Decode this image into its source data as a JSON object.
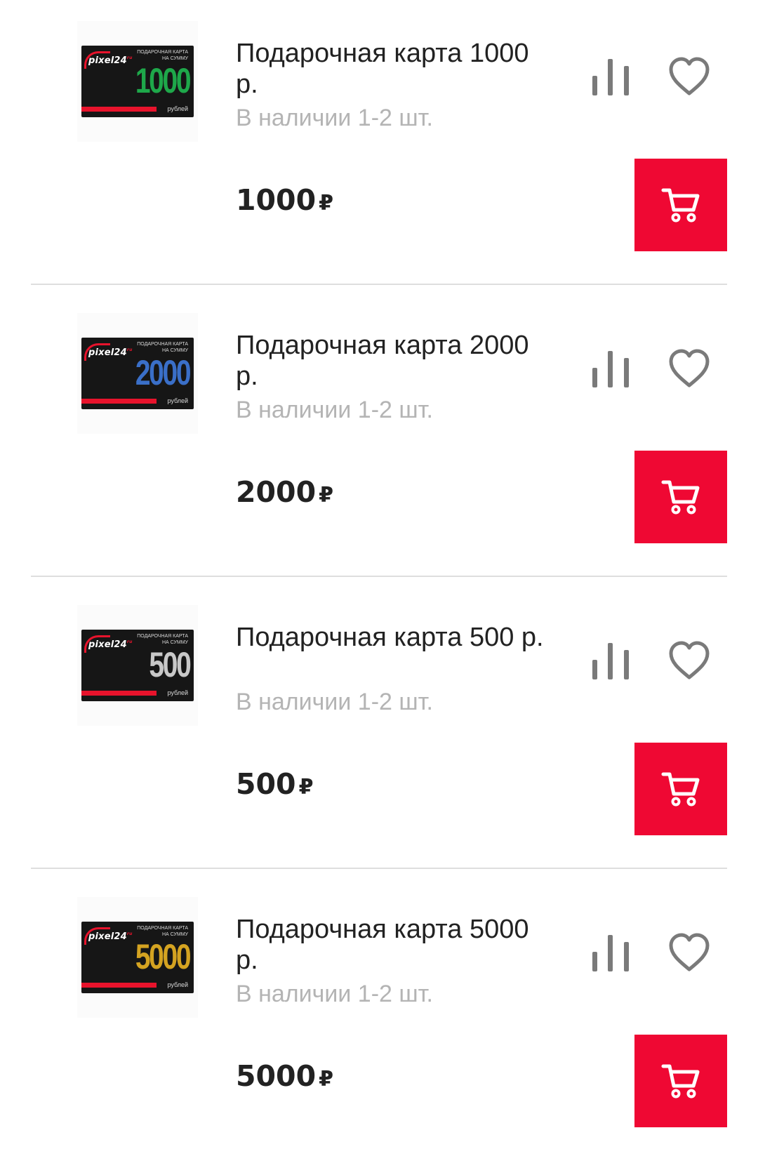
{
  "colors": {
    "accent_red": "#ef0833",
    "title_text": "#222222",
    "stock_text": "#b4b4b4",
    "divider": "#dedede",
    "icon_gray": "#7a7a7a"
  },
  "card_caption_line1": "ПОДАРОЧНАЯ КАРТА",
  "card_caption_line2": "НА СУММУ",
  "card_rub_label": "рублей",
  "card_logo": "pixel24",
  "card_logo_suffix": "ru",
  "icons": {
    "compare": "bar-chart-icon",
    "favorite": "heart-icon",
    "cart": "shopping-cart-icon"
  },
  "products": [
    {
      "title": "Подарочная карта 1000 р.",
      "stock": "В наличии 1-2 шт.",
      "price": "1000",
      "currency": "₽",
      "card_amount": "1000",
      "card_color": "#1ea84a"
    },
    {
      "title": "Подарочная карта 2000 р.",
      "stock": "В наличии 1-2 шт.",
      "price": "2000",
      "currency": "₽",
      "card_amount": "2000",
      "card_color": "#3a6fc8"
    },
    {
      "title": "Подарочная карта 500 р.",
      "stock": "В наличии 1-2 шт.",
      "price": "500",
      "currency": "₽",
      "card_amount": "500",
      "card_color": "#c8c8c8"
    },
    {
      "title": "Подарочная карта 5000 р.",
      "stock": "В наличии 1-2 шт.",
      "price": "5000",
      "currency": "₽",
      "card_amount": "5000",
      "card_color": "#d4a321"
    }
  ]
}
